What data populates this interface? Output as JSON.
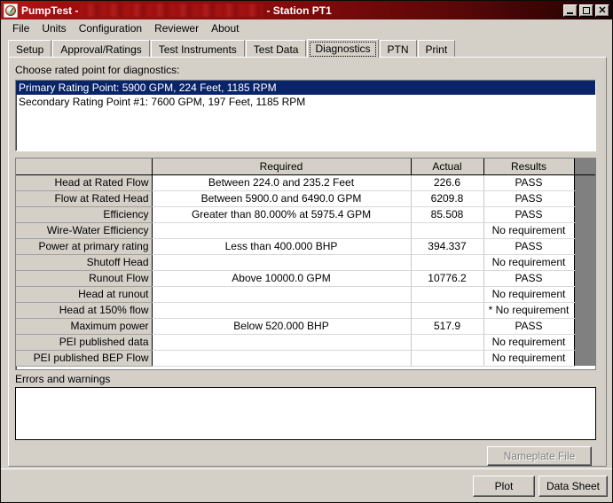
{
  "window": {
    "title_prefix": "PumpTest -",
    "title_suffix": "- Station PT1",
    "icon": "gauge-icon",
    "controls": {
      "minimize": "_",
      "maximize": "□",
      "close": "✕"
    }
  },
  "menu": {
    "items": [
      "File",
      "Units",
      "Configuration",
      "Reviewer",
      "About"
    ]
  },
  "tabs": {
    "items": [
      "Setup",
      "Approval/Ratings",
      "Test Instruments",
      "Test Data",
      "Diagnostics",
      "PTN",
      "Print"
    ],
    "active": "Diagnostics"
  },
  "page": {
    "choose_label": "Choose rated point for diagnostics:",
    "rating_points": [
      {
        "text": "Primary Rating Point: 5900 GPM, 224 Feet, 1185 RPM",
        "selected": true
      },
      {
        "text": "Secondary Rating Point #1: 7600 GPM, 197 Feet, 1185 RPM",
        "selected": false
      }
    ],
    "grid": {
      "headers": [
        "",
        "Required",
        "Actual",
        "Results"
      ],
      "rows": [
        {
          "name": "Head at Rated Flow",
          "required": "Between 224.0 and 235.2 Feet",
          "actual": "226.6",
          "results": "PASS"
        },
        {
          "name": "Flow at Rated Head",
          "required": "Between 5900.0 and 6490.0 GPM",
          "actual": "6209.8",
          "results": "PASS"
        },
        {
          "name": "Efficiency",
          "required": "Greater than 80.000% at 5975.4 GPM",
          "actual": "85.508",
          "results": "PASS"
        },
        {
          "name": "Wire-Water Efficiency",
          "required": "",
          "actual": "",
          "results": "No requirement"
        },
        {
          "name": "Power at primary rating",
          "required": "Less than 400.000 BHP",
          "actual": "394.337",
          "results": "PASS"
        },
        {
          "name": "Shutoff Head",
          "required": "",
          "actual": "",
          "results": "No requirement"
        },
        {
          "name": "Runout Flow",
          "required": "Above 10000.0 GPM",
          "actual": "10776.2",
          "results": "PASS"
        },
        {
          "name": "Head at runout",
          "required": "",
          "actual": "",
          "results": "No requirement"
        },
        {
          "name": "Head at 150% flow",
          "required": "",
          "actual": "",
          "results": "* No requirement"
        },
        {
          "name": "Maximum power",
          "required": "Below 520.000 BHP",
          "actual": "517.9",
          "results": "PASS"
        },
        {
          "name": "PEI published data",
          "required": "",
          "actual": "",
          "results": "No requirement"
        },
        {
          "name": "PEI published BEP Flow",
          "required": "",
          "actual": "",
          "results": "No requirement"
        }
      ]
    },
    "errors_label": "Errors and warnings",
    "errors_text": "",
    "nameplate_button": "Nameplate File"
  },
  "footer": {
    "plot_button": "Plot",
    "datasheet_button": "Data Sheet"
  },
  "colors": {
    "titlebar": "#9c0f0f",
    "face": "#d4d0c8",
    "selection": "#0a246a",
    "gutter": "#808080"
  }
}
